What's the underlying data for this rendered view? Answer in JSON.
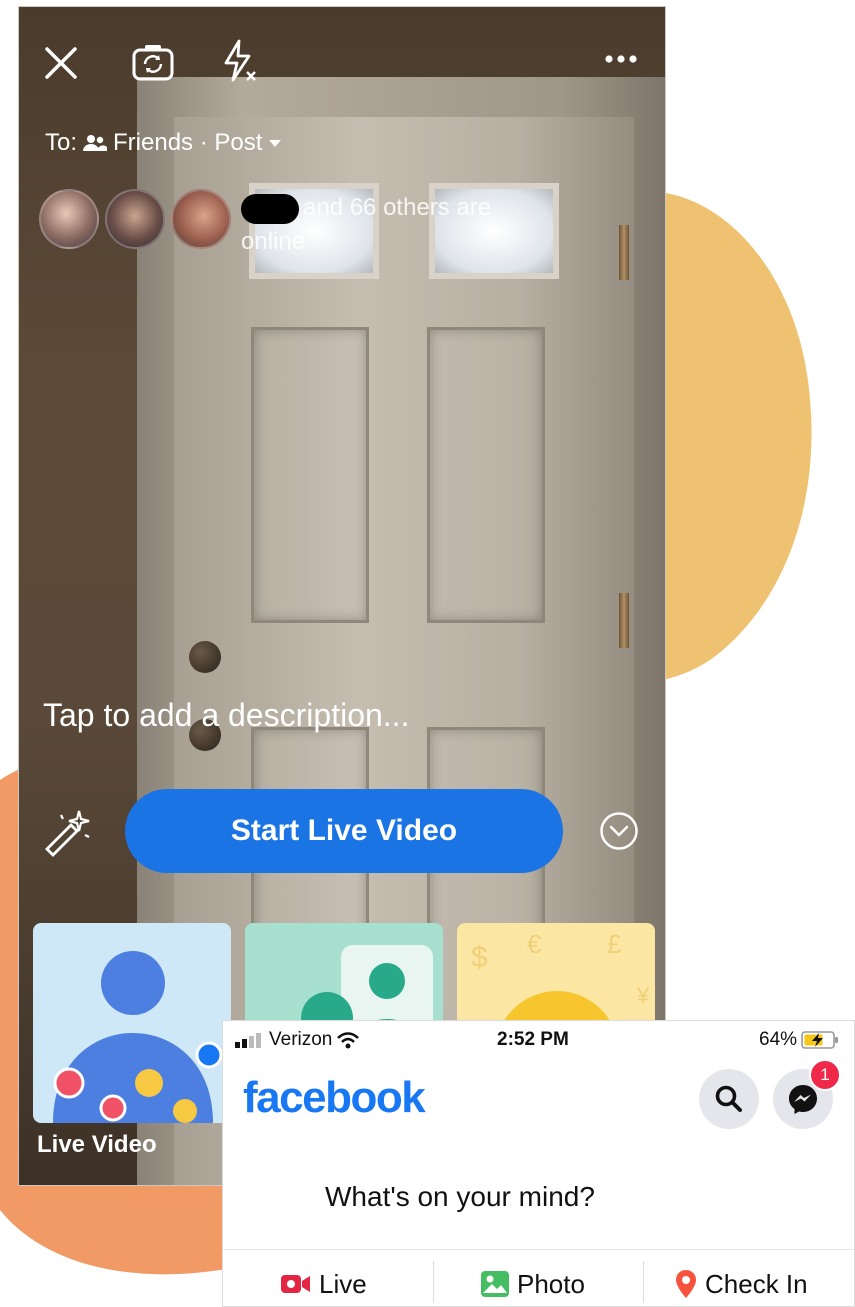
{
  "colors": {
    "accent": "#1b74e4",
    "facebook_blue": "#1877f2",
    "blob_yellow": "#efc272",
    "blob_orange": "#f19a66",
    "badge_red": "#f02849"
  },
  "live": {
    "topbar": {
      "close_icon": "close-icon",
      "flip_icon": "camera-flip-icon",
      "flash_icon": "flash-off-icon",
      "more_icon": "more-icon"
    },
    "audience": {
      "prefix": "To:",
      "label": "Friends · Post"
    },
    "online_text": "and 66 others are online",
    "description_placeholder": "Tap to add a description...",
    "start_button": "Start Live Video",
    "cards": [
      {
        "label": "Live Video"
      }
    ]
  },
  "fb": {
    "status": {
      "carrier": "Verizon",
      "time": "2:52 PM",
      "battery": "64%"
    },
    "logo": "facebook",
    "messenger_badge": "1",
    "composer_placeholder": "What's on your mind?",
    "actions": {
      "live": "Live",
      "photo": "Photo",
      "checkin": "Check In"
    }
  }
}
